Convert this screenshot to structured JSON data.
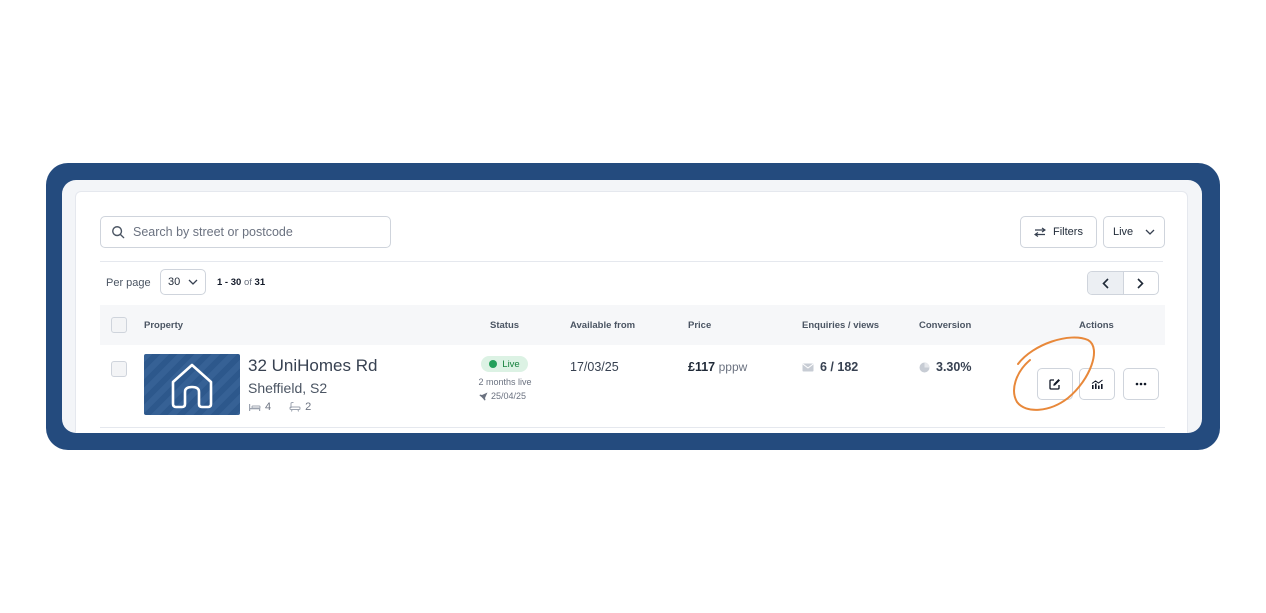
{
  "search": {
    "placeholder": "Search by street or postcode",
    "icon": "search-icon"
  },
  "toolbar": {
    "filters_label": "Filters",
    "status_value": "Live"
  },
  "pagination": {
    "per_page_label": "Per page",
    "per_page_value": "30",
    "range_start": "1",
    "range_end": "30",
    "range_of": "of",
    "total": "31"
  },
  "table": {
    "columns": {
      "property": "Property",
      "status": "Status",
      "available_from": "Available from",
      "price": "Price",
      "enquiries_views": "Enquiries / views",
      "conversion": "Conversion",
      "actions": "Actions"
    },
    "rows": [
      {
        "title": "32 UniHomes Rd",
        "location": "Sheffield, S2",
        "bedrooms": "4",
        "bathrooms": "2",
        "status": "Live",
        "status_duration": "2 months live",
        "published": "25/04/25",
        "available_from": "17/03/25",
        "price": "£117",
        "price_unit": "pppw",
        "enquiries_views": "6 / 182",
        "conversion": "3.30%"
      }
    ]
  },
  "colors": {
    "frame": "#244b7e",
    "live_green": "#22a05a",
    "annotation": "#e8883a"
  }
}
